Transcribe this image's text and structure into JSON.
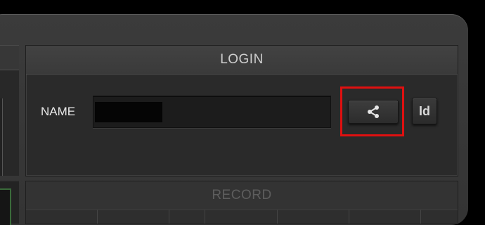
{
  "login": {
    "title": "LOGIN",
    "name_label": "NAME",
    "name_value": "",
    "share_icon": "share-icon",
    "id_label": "Id"
  },
  "record": {
    "title": "RECORD"
  },
  "colors": {
    "background": "#000000",
    "frame": "#383838",
    "panel": "#2a2a2a",
    "highlight": "#e01010",
    "label": "#e8e8e8"
  }
}
